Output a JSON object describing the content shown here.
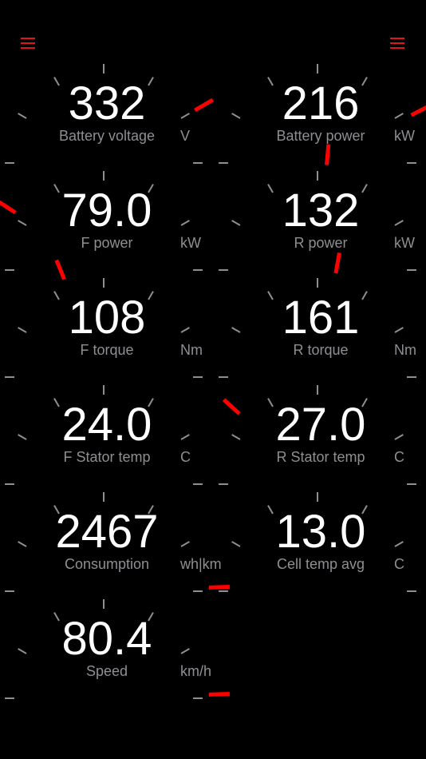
{
  "menu": {
    "left_icon": "hamburger-menu-icon",
    "right_icon": "hamburger-menu-icon",
    "color": "#e0141d"
  },
  "colors": {
    "background": "#000000",
    "value_text": "#ffffff",
    "label_text": "#8e8e93",
    "tick": "#8e8e93",
    "needle": "#ff0000"
  },
  "gauges": [
    {
      "value": "332",
      "label": "Battery voltage",
      "unit": "V",
      "needle_angle": 60
    },
    {
      "value": "216",
      "label": "Battery power",
      "unit": "kW",
      "needle_angle": 63
    },
    {
      "value": "79.0",
      "label": "F power",
      "unit": "kW",
      "needle_angle": -57
    },
    {
      "value": "132",
      "label": "R power",
      "unit": "kW",
      "needle_angle": 5
    },
    {
      "value": "108",
      "label": "F torque",
      "unit": "Nm",
      "needle_angle": -22
    },
    {
      "value": "161",
      "label": "R torque",
      "unit": "Nm",
      "needle_angle": 10
    },
    {
      "value": "24.0",
      "label": "F Stator temp",
      "unit": "C",
      "needle_angle": null
    },
    {
      "value": "27.0",
      "label": "R Stator temp",
      "unit": "C",
      "needle_angle": -48
    },
    {
      "value": "2467",
      "label": "Consumption",
      "unit": "wh|km",
      "needle_angle": 88
    },
    {
      "value": "13.0",
      "label": "Cell temp avg",
      "unit": "C",
      "needle_angle": null
    },
    {
      "value": "80.4",
      "label": "Speed",
      "unit": "km/h",
      "needle_angle": 88
    }
  ]
}
